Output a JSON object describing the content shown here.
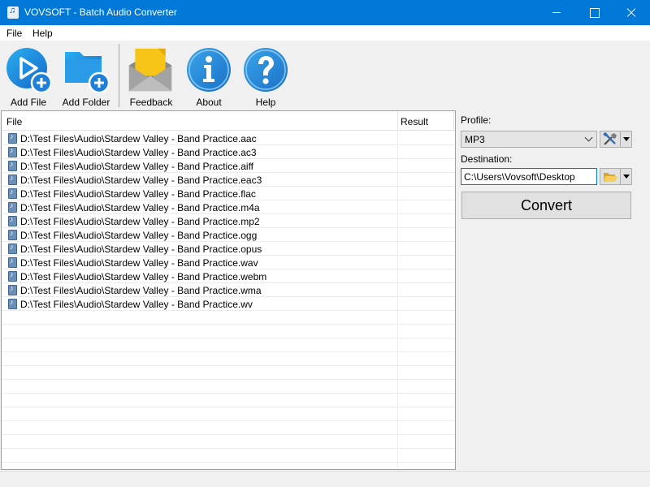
{
  "window": {
    "title": "VOVSOFT - Batch Audio Converter"
  },
  "menu": [
    {
      "label": "File"
    },
    {
      "label": "Help"
    }
  ],
  "toolbar": {
    "add_file": "Add File",
    "add_folder": "Add Folder",
    "feedback": "Feedback",
    "about": "About",
    "help": "Help"
  },
  "list": {
    "columns": {
      "file": "File",
      "result": "Result"
    },
    "rows": [
      {
        "file": "D:\\Test Files\\Audio\\Stardew Valley - Band Practice.aac",
        "result": ""
      },
      {
        "file": "D:\\Test Files\\Audio\\Stardew Valley - Band Practice.ac3",
        "result": ""
      },
      {
        "file": "D:\\Test Files\\Audio\\Stardew Valley - Band Practice.aiff",
        "result": ""
      },
      {
        "file": "D:\\Test Files\\Audio\\Stardew Valley - Band Practice.eac3",
        "result": ""
      },
      {
        "file": "D:\\Test Files\\Audio\\Stardew Valley - Band Practice.flac",
        "result": ""
      },
      {
        "file": "D:\\Test Files\\Audio\\Stardew Valley - Band Practice.m4a",
        "result": ""
      },
      {
        "file": "D:\\Test Files\\Audio\\Stardew Valley - Band Practice.mp2",
        "result": ""
      },
      {
        "file": "D:\\Test Files\\Audio\\Stardew Valley - Band Practice.ogg",
        "result": ""
      },
      {
        "file": "D:\\Test Files\\Audio\\Stardew Valley - Band Practice.opus",
        "result": ""
      },
      {
        "file": "D:\\Test Files\\Audio\\Stardew Valley - Band Practice.wav",
        "result": ""
      },
      {
        "file": "D:\\Test Files\\Audio\\Stardew Valley - Band Practice.webm",
        "result": ""
      },
      {
        "file": "D:\\Test Files\\Audio\\Stardew Valley - Band Practice.wma",
        "result": ""
      },
      {
        "file": "D:\\Test Files\\Audio\\Stardew Valley - Band Practice.wv",
        "result": ""
      }
    ],
    "empty_rows": 11
  },
  "settings": {
    "profile_label": "Profile:",
    "profile_value": "MP3",
    "destination_label": "Destination:",
    "destination_value": "C:\\Users\\Vovsoft\\Desktop",
    "convert_label": "Convert"
  },
  "icons": {
    "add_file": "play-plus-icon",
    "add_folder": "folder-plus-icon",
    "feedback": "envelope-icon",
    "about": "info-icon",
    "help": "question-icon",
    "profile_settings": "tools-icon",
    "browse": "folder-open-icon"
  },
  "colors": {
    "titlebar": "#0078d7",
    "icon_blue": "#1e88d6",
    "envelope_yellow": "#f7c518"
  }
}
